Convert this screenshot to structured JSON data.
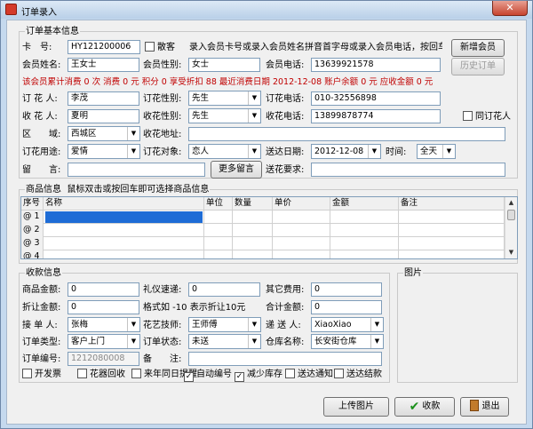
{
  "window": {
    "title": "订单录入",
    "close": "✕"
  },
  "basic": {
    "group_title": "订单基本信息",
    "card_label": "卡　号:",
    "card_value": "HY121200006",
    "walkin_label": "散客",
    "hint": "录入会员卡号或录入会员姓名拼音首字母或录入会员电话，按回车…",
    "new_member": "新增会员",
    "member_name_label": "会员姓名:",
    "member_name": "王女士",
    "member_gender_label": "会员性别:",
    "member_gender": "女士",
    "member_phone_label": "会员电话:",
    "member_phone": "13639921578",
    "history": "历史订单",
    "summary": "该会员累计消费 0 次 消费 0 元 积分 0 享受折扣 88 最近消费日期 2012-12-08 账户余额 0 元 应收金额 0 元",
    "orderer_label": "订 花 人:",
    "orderer": "李茂",
    "orderer_gender_label": "订花性别:",
    "orderer_gender": "先生",
    "orderer_phone_label": "订花电话:",
    "orderer_phone": "010-32556898",
    "receiver_label": "收 花 人:",
    "receiver": "夏明",
    "receiver_gender_label": "收花性别:",
    "receiver_gender": "先生",
    "receiver_phone_label": "收花电话:",
    "receiver_phone": "13899878774",
    "same_person": "同订花人",
    "district_label": "区　　域:",
    "district": "西城区",
    "address_label": "收花地址:",
    "address": "",
    "purpose_label": "订花用途:",
    "purpose": "爱情",
    "target_label": "订花对象:",
    "target": "恋人",
    "date_label": "送达日期:",
    "date": "2012-12-08",
    "time_label": "时间:",
    "time": "全天",
    "message_label": "留　　言:",
    "message": "",
    "more_message": "更多留言",
    "requirement_label": "送花要求:",
    "requirement": ""
  },
  "goods": {
    "group_title": "商品信息",
    "hint": "鼠标双击或按回车即可选择商品信息",
    "columns": [
      "序号",
      "名称",
      "单位",
      "数量",
      "单价",
      "金额",
      "备注"
    ],
    "rows": [
      "@ 1",
      "@ 2",
      "@ 3",
      "@ 4"
    ]
  },
  "payment": {
    "group_title": "收款信息",
    "goods_total_label": "商品金额:",
    "goods_total": "0",
    "gift_fee_label": "礼仪速递:",
    "gift_fee": "0",
    "other_fee_label": "其它费用:",
    "other_fee": "0",
    "discount_label": "折让金额:",
    "discount": "0",
    "format_hint": "格式如 -10 表示折让10元",
    "total_label": "合计金额:",
    "total": "0",
    "handler_label": "接 单 人:",
    "handler": "张梅",
    "florist_label": "花艺技师:",
    "florist": "王师傅",
    "courier_label": "递 送 人:",
    "courier": "XiaoXiao",
    "order_type_label": "订单类型:",
    "order_type": "客户上门",
    "order_status_label": "订单状态:",
    "order_status": "未送",
    "warehouse_label": "仓库名称:",
    "warehouse": "长安街仓库",
    "order_no_label": "订单编号:",
    "order_no": "1212080008",
    "remark_label": "备　　注:",
    "remark": ""
  },
  "options": [
    {
      "label": "开发票",
      "checked": false
    },
    {
      "label": "花器回收",
      "checked": false
    },
    {
      "label": "来年同日提醒",
      "checked": false
    },
    {
      "label": "自动编号",
      "checked": true
    },
    {
      "label": "减少库存",
      "checked": true
    },
    {
      "label": "送达通知",
      "checked": false
    },
    {
      "label": "送达结款",
      "checked": false
    }
  ],
  "image_group_title": "图片",
  "buttons": {
    "upload": "上传图片",
    "collect": "收款",
    "exit": "退出"
  },
  "icons": {
    "ok": "checkmark-icon",
    "exit": "door-exit-icon",
    "dropdown": "chevron-down-icon"
  }
}
